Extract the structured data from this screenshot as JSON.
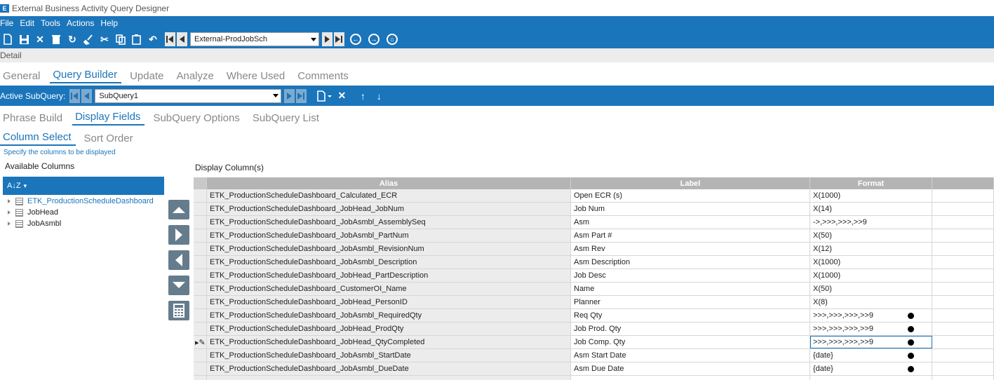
{
  "window": {
    "title": "External Business Activity Query Designer",
    "logo_text": "E"
  },
  "menu": {
    "items": [
      "File",
      "Edit",
      "Tools",
      "Actions",
      "Help"
    ]
  },
  "toolbar": {
    "icons": [
      "new-icon",
      "save-icon",
      "delete-icon",
      "trash-icon",
      "refresh-icon",
      "clear-icon",
      "cut-icon",
      "copy-icon",
      "paste-icon",
      "undo-icon"
    ],
    "record_combo": "External-ProdJobSch"
  },
  "detail_label": "Detail",
  "main_tabs": [
    "General",
    "Query Builder",
    "Update",
    "Analyze",
    "Where Used",
    "Comments"
  ],
  "main_tabs_active": "Query Builder",
  "subquery": {
    "label": "Active SubQuery:",
    "value": "SubQuery1"
  },
  "sub_tabs": [
    "Phrase Build",
    "Display Fields",
    "SubQuery Options",
    "SubQuery List"
  ],
  "sub_tabs_active": "Display Fields",
  "inner_tabs": [
    "Column Select",
    "Sort Order"
  ],
  "inner_tabs_active": "Column Select",
  "hint": "Specify the columns to be displayed",
  "available": {
    "title": "Available Columns",
    "sort_icon_text": "A↓Z",
    "items": [
      "ETK_ProductionScheduleDashboard",
      "JobHead",
      "JobAsmbl"
    ]
  },
  "display": {
    "title": "Display Column(s)",
    "columns": [
      "Alias",
      "Label",
      "Format"
    ],
    "rows": [
      {
        "alias": "ETK_ProductionScheduleDashboard_Calculated_ECR",
        "label": "Open ECR (s)",
        "format": "X(1000)",
        "dot": false
      },
      {
        "alias": "ETK_ProductionScheduleDashboard_JobHead_JobNum",
        "label": "Job Num",
        "format": "X(14)",
        "dot": false
      },
      {
        "alias": "ETK_ProductionScheduleDashboard_JobAsmbl_AssemblySeq",
        "label": "Asm",
        "format": "->,>>>,>>>,>>9",
        "dot": false
      },
      {
        "alias": "ETK_ProductionScheduleDashboard_JobAsmbl_PartNum",
        "label": "Asm Part #",
        "format": "X(50)",
        "dot": false
      },
      {
        "alias": "ETK_ProductionScheduleDashboard_JobAsmbl_RevisionNum",
        "label": "Asm Rev",
        "format": "X(12)",
        "dot": false
      },
      {
        "alias": "ETK_ProductionScheduleDashboard_JobAsmbl_Description",
        "label": "Asm Description",
        "format": "X(1000)",
        "dot": false
      },
      {
        "alias": "ETK_ProductionScheduleDashboard_JobHead_PartDescription",
        "label": "Job Desc",
        "format": "X(1000)",
        "dot": false
      },
      {
        "alias": "ETK_ProductionScheduleDashboard_CustomerOI_Name",
        "label": "Name",
        "format": "X(50)",
        "dot": false
      },
      {
        "alias": "ETK_ProductionScheduleDashboard_JobHead_PersonID",
        "label": "Planner",
        "format": "X(8)",
        "dot": false
      },
      {
        "alias": "ETK_ProductionScheduleDashboard_JobAsmbl_RequiredQty",
        "label": "Req Qty",
        "format": ">>>,>>>,>>>,>>9",
        "dot": true
      },
      {
        "alias": "ETK_ProductionScheduleDashboard_JobHead_ProdQty",
        "label": "Job Prod. Qty",
        "format": ">>>,>>>,>>>,>>9",
        "dot": true
      },
      {
        "alias": "ETK_ProductionScheduleDashboard_JobHead_QtyCompleted",
        "label": "Job Comp. Qty",
        "format": ">>>,>>>,>>>,>>9",
        "dot": true
      },
      {
        "alias": "ETK_ProductionScheduleDashboard_JobAsmbl_StartDate",
        "label": "Asm Start Date",
        "format": "{date}",
        "dot": true
      },
      {
        "alias": "ETK_ProductionScheduleDashboard_JobAsmbl_DueDate",
        "label": "Asm Due Date",
        "format": "{date}",
        "dot": true
      },
      {
        "alias": "",
        "label": "",
        "format": "",
        "dot": false
      }
    ],
    "current_row": 11
  },
  "colors": {
    "accent": "#1b75bb",
    "header_gray": "#b4b4b4",
    "side_button": "#657c8c"
  }
}
